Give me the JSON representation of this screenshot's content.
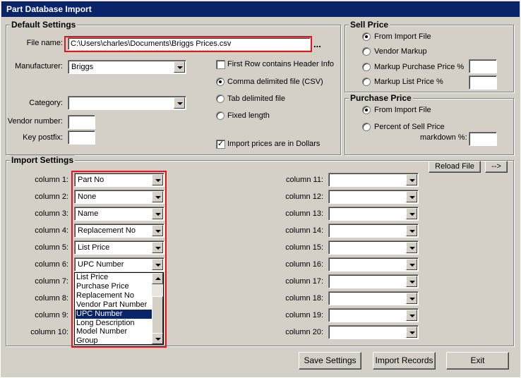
{
  "window": {
    "title": "Part Database Import"
  },
  "default_settings": {
    "title": "Default Settings",
    "file_name_label": "File name:",
    "file_name_value": "C:\\Users\\charles\\Documents\\Briggs Prices.csv",
    "browse_label": "...",
    "manufacturer_label": "Manufacturer:",
    "manufacturer_value": "Briggs",
    "category_label": "Category:",
    "category_value": "",
    "vendor_number_label": "Vendor number:",
    "vendor_number_value": "",
    "key_postfix_label": "Key postfix:",
    "key_postfix_value": "",
    "first_row_header": {
      "label": "First Row contains Header Info",
      "checked": false
    },
    "format_options": [
      {
        "label": "Comma delimited file (CSV)",
        "selected": true
      },
      {
        "label": "Tab delimited file",
        "selected": false
      },
      {
        "label": "Fixed length",
        "selected": false
      }
    ],
    "import_dollars": {
      "label": "Import prices are in Dollars",
      "checked": true,
      "mark": "✓"
    }
  },
  "sell_price": {
    "title": "Sell Price",
    "options": [
      {
        "label": "From Import File",
        "selected": true
      },
      {
        "label": "Vendor Markup",
        "selected": false
      },
      {
        "label": "Markup Purchase Price %",
        "selected": false
      },
      {
        "label": "Markup List Price %",
        "selected": false
      }
    ],
    "markup_purchase_value": "",
    "markup_list_value": ""
  },
  "purchase_price": {
    "title": "Purchase Price",
    "options": [
      {
        "label": "From Import File",
        "selected": true
      },
      {
        "label": "Percent of Sell Price",
        "selected": false
      }
    ],
    "markdown_label": "markdown %:",
    "markdown_value": ""
  },
  "import_settings": {
    "title": "Import Settings",
    "reload_file_label": "Reload File",
    "arrow_button_label": "-->",
    "columns_left": [
      {
        "label": "column 1:",
        "value": "Part No"
      },
      {
        "label": "column 2:",
        "value": "None"
      },
      {
        "label": "column 3:",
        "value": "Name"
      },
      {
        "label": "column 4:",
        "value": "Replacement No"
      },
      {
        "label": "column 5:",
        "value": "List Price"
      },
      {
        "label": "column 6:",
        "value": "UPC Number"
      },
      {
        "label": "column 7:",
        "value": ""
      },
      {
        "label": "column 8:",
        "value": ""
      },
      {
        "label": "column 9:",
        "value": ""
      },
      {
        "label": "column 10:",
        "value": ""
      }
    ],
    "columns_right": [
      {
        "label": "column 11:",
        "value": ""
      },
      {
        "label": "column 12:",
        "value": ""
      },
      {
        "label": "column 13:",
        "value": ""
      },
      {
        "label": "column 14:",
        "value": ""
      },
      {
        "label": "column 15:",
        "value": ""
      },
      {
        "label": "column 16:",
        "value": ""
      },
      {
        "label": "column 17:",
        "value": ""
      },
      {
        "label": "column 18:",
        "value": ""
      },
      {
        "label": "column 19:",
        "value": ""
      },
      {
        "label": "column 20:",
        "value": ""
      }
    ],
    "dropdown_options": [
      "List Price",
      "Purchase Price",
      "Replacement No",
      "Vendor Part Number",
      "UPC Number",
      "Long Description",
      "Model Number",
      "Group"
    ],
    "dropdown_selected": "UPC Number"
  },
  "footer": {
    "save_settings_label": "Save Settings",
    "import_records_label": "Import Records",
    "exit_label": "Exit"
  },
  "colors": {
    "title_bar": "#0a246a",
    "highlight_box": "#e0161e",
    "selection": "#0a246a",
    "face": "#d4d0c8"
  },
  "icons": [
    "dropdown-arrow-icon",
    "scroll-up-icon",
    "scroll-down-icon"
  ]
}
